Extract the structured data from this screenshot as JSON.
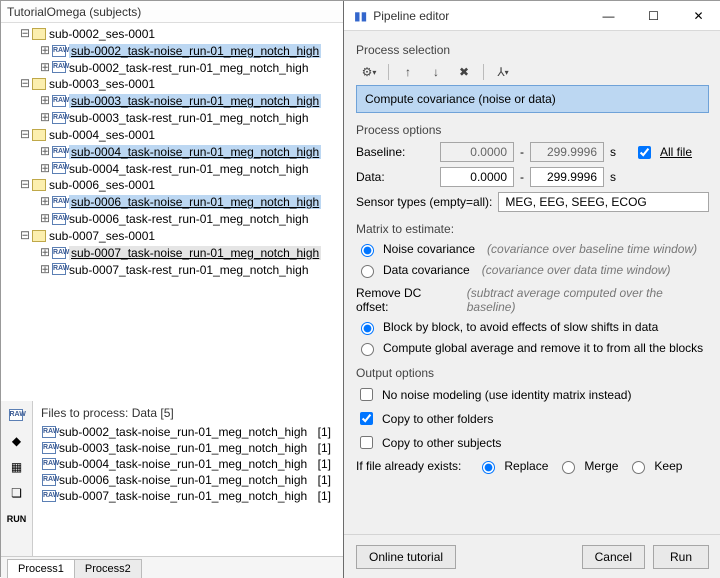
{
  "left": {
    "root_title": "TutorialOmega (subjects)",
    "subjects": [
      {
        "name": "sub-0002_ses-0001",
        "runs": [
          {
            "label": "sub-0002_task-noise_run-01_meg_notch_high",
            "sel": true
          },
          {
            "label": "sub-0002_task-rest_run-01_meg_notch_high",
            "sel": false
          }
        ]
      },
      {
        "name": "sub-0003_ses-0001",
        "runs": [
          {
            "label": "sub-0003_task-noise_run-01_meg_notch_high",
            "sel": true
          },
          {
            "label": "sub-0003_task-rest_run-01_meg_notch_high",
            "sel": false
          }
        ]
      },
      {
        "name": "sub-0004_ses-0001",
        "runs": [
          {
            "label": "sub-0004_task-noise_run-01_meg_notch_high",
            "sel": true
          },
          {
            "label": "sub-0004_task-rest_run-01_meg_notch_high",
            "sel": false
          }
        ]
      },
      {
        "name": "sub-0006_ses-0001",
        "runs": [
          {
            "label": "sub-0006_task-noise_run-01_meg_notch_high",
            "sel": true
          },
          {
            "label": "sub-0006_task-rest_run-01_meg_notch_high",
            "sel": false
          }
        ]
      },
      {
        "name": "sub-0007_ses-0001",
        "runs": [
          {
            "label": "sub-0007_task-noise_run-01_meg_notch_high",
            "sel": true,
            "gray": true
          },
          {
            "label": "sub-0007_task-rest_run-01_meg_notch_high",
            "sel": false
          }
        ]
      }
    ],
    "files_title": "Files to process: Data [5]",
    "files": [
      {
        "name": "sub-0002_task-noise_run-01_meg_notch_high",
        "count": "[1]"
      },
      {
        "name": "sub-0003_task-noise_run-01_meg_notch_high",
        "count": "[1]"
      },
      {
        "name": "sub-0004_task-noise_run-01_meg_notch_high",
        "count": "[1]"
      },
      {
        "name": "sub-0006_task-noise_run-01_meg_notch_high",
        "count": "[1]"
      },
      {
        "name": "sub-0007_task-noise_run-01_meg_notch_high",
        "count": "[1]"
      }
    ],
    "tabs": [
      "Process1",
      "Process2"
    ],
    "toolstrip_run": "RUN"
  },
  "dialog": {
    "title": "Pipeline editor",
    "proc_selection_label": "Process selection",
    "selected_process": "Compute covariance (noise or data)",
    "proc_options_label": "Process options",
    "baseline_label": "Baseline:",
    "baseline_from": "0.0000",
    "baseline_to": "299.9996",
    "sec_unit": "s",
    "all_file_label": "All file",
    "data_label": "Data:",
    "data_from": "0.0000",
    "data_to": "299.9996",
    "sensor_label": "Sensor types (empty=all):",
    "sensor_value": "MEG, EEG, SEEG, ECOG",
    "matrix_label": "Matrix to estimate:",
    "radio_noise": "Noise covariance",
    "hint_noise": "(covariance over baseline time window)",
    "radio_data": "Data covariance",
    "hint_data": "(covariance over data time window)",
    "removedc_label": "Remove DC offset:",
    "hint_dc": "(subtract average computed over the baseline)",
    "radio_block": "Block by block, to avoid effects of slow shifts in data",
    "radio_global": "Compute global average and remove it to from all the blocks",
    "output_label": "Output options",
    "chk_nomodel": "No noise modeling (use identity matrix instead)",
    "chk_copy_folders": "Copy to other folders",
    "chk_copy_subjects": "Copy to other subjects",
    "exists_label": "If file already exists:",
    "opt_replace": "Replace",
    "opt_merge": "Merge",
    "opt_keep": "Keep",
    "btn_tutorial": "Online tutorial",
    "btn_cancel": "Cancel",
    "btn_run": "Run"
  }
}
